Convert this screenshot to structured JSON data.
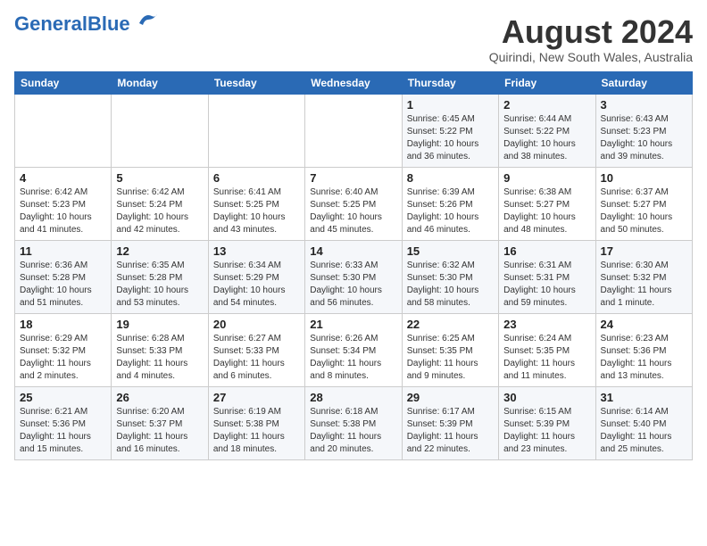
{
  "header": {
    "logo_general": "General",
    "logo_blue": "Blue",
    "month_year": "August 2024",
    "location": "Quirindi, New South Wales, Australia"
  },
  "days_of_week": [
    "Sunday",
    "Monday",
    "Tuesday",
    "Wednesday",
    "Thursday",
    "Friday",
    "Saturday"
  ],
  "weeks": [
    [
      {
        "day": "",
        "info": ""
      },
      {
        "day": "",
        "info": ""
      },
      {
        "day": "",
        "info": ""
      },
      {
        "day": "",
        "info": ""
      },
      {
        "day": "1",
        "info": "Sunrise: 6:45 AM\nSunset: 5:22 PM\nDaylight: 10 hours\nand 36 minutes."
      },
      {
        "day": "2",
        "info": "Sunrise: 6:44 AM\nSunset: 5:22 PM\nDaylight: 10 hours\nand 38 minutes."
      },
      {
        "day": "3",
        "info": "Sunrise: 6:43 AM\nSunset: 5:23 PM\nDaylight: 10 hours\nand 39 minutes."
      }
    ],
    [
      {
        "day": "4",
        "info": "Sunrise: 6:42 AM\nSunset: 5:23 PM\nDaylight: 10 hours\nand 41 minutes."
      },
      {
        "day": "5",
        "info": "Sunrise: 6:42 AM\nSunset: 5:24 PM\nDaylight: 10 hours\nand 42 minutes."
      },
      {
        "day": "6",
        "info": "Sunrise: 6:41 AM\nSunset: 5:25 PM\nDaylight: 10 hours\nand 43 minutes."
      },
      {
        "day": "7",
        "info": "Sunrise: 6:40 AM\nSunset: 5:25 PM\nDaylight: 10 hours\nand 45 minutes."
      },
      {
        "day": "8",
        "info": "Sunrise: 6:39 AM\nSunset: 5:26 PM\nDaylight: 10 hours\nand 46 minutes."
      },
      {
        "day": "9",
        "info": "Sunrise: 6:38 AM\nSunset: 5:27 PM\nDaylight: 10 hours\nand 48 minutes."
      },
      {
        "day": "10",
        "info": "Sunrise: 6:37 AM\nSunset: 5:27 PM\nDaylight: 10 hours\nand 50 minutes."
      }
    ],
    [
      {
        "day": "11",
        "info": "Sunrise: 6:36 AM\nSunset: 5:28 PM\nDaylight: 10 hours\nand 51 minutes."
      },
      {
        "day": "12",
        "info": "Sunrise: 6:35 AM\nSunset: 5:28 PM\nDaylight: 10 hours\nand 53 minutes."
      },
      {
        "day": "13",
        "info": "Sunrise: 6:34 AM\nSunset: 5:29 PM\nDaylight: 10 hours\nand 54 minutes."
      },
      {
        "day": "14",
        "info": "Sunrise: 6:33 AM\nSunset: 5:30 PM\nDaylight: 10 hours\nand 56 minutes."
      },
      {
        "day": "15",
        "info": "Sunrise: 6:32 AM\nSunset: 5:30 PM\nDaylight: 10 hours\nand 58 minutes."
      },
      {
        "day": "16",
        "info": "Sunrise: 6:31 AM\nSunset: 5:31 PM\nDaylight: 10 hours\nand 59 minutes."
      },
      {
        "day": "17",
        "info": "Sunrise: 6:30 AM\nSunset: 5:32 PM\nDaylight: 11 hours\nand 1 minute."
      }
    ],
    [
      {
        "day": "18",
        "info": "Sunrise: 6:29 AM\nSunset: 5:32 PM\nDaylight: 11 hours\nand 2 minutes."
      },
      {
        "day": "19",
        "info": "Sunrise: 6:28 AM\nSunset: 5:33 PM\nDaylight: 11 hours\nand 4 minutes."
      },
      {
        "day": "20",
        "info": "Sunrise: 6:27 AM\nSunset: 5:33 PM\nDaylight: 11 hours\nand 6 minutes."
      },
      {
        "day": "21",
        "info": "Sunrise: 6:26 AM\nSunset: 5:34 PM\nDaylight: 11 hours\nand 8 minutes."
      },
      {
        "day": "22",
        "info": "Sunrise: 6:25 AM\nSunset: 5:35 PM\nDaylight: 11 hours\nand 9 minutes."
      },
      {
        "day": "23",
        "info": "Sunrise: 6:24 AM\nSunset: 5:35 PM\nDaylight: 11 hours\nand 11 minutes."
      },
      {
        "day": "24",
        "info": "Sunrise: 6:23 AM\nSunset: 5:36 PM\nDaylight: 11 hours\nand 13 minutes."
      }
    ],
    [
      {
        "day": "25",
        "info": "Sunrise: 6:21 AM\nSunset: 5:36 PM\nDaylight: 11 hours\nand 15 minutes."
      },
      {
        "day": "26",
        "info": "Sunrise: 6:20 AM\nSunset: 5:37 PM\nDaylight: 11 hours\nand 16 minutes."
      },
      {
        "day": "27",
        "info": "Sunrise: 6:19 AM\nSunset: 5:38 PM\nDaylight: 11 hours\nand 18 minutes."
      },
      {
        "day": "28",
        "info": "Sunrise: 6:18 AM\nSunset: 5:38 PM\nDaylight: 11 hours\nand 20 minutes."
      },
      {
        "day": "29",
        "info": "Sunrise: 6:17 AM\nSunset: 5:39 PM\nDaylight: 11 hours\nand 22 minutes."
      },
      {
        "day": "30",
        "info": "Sunrise: 6:15 AM\nSunset: 5:39 PM\nDaylight: 11 hours\nand 23 minutes."
      },
      {
        "day": "31",
        "info": "Sunrise: 6:14 AM\nSunset: 5:40 PM\nDaylight: 11 hours\nand 25 minutes."
      }
    ]
  ]
}
